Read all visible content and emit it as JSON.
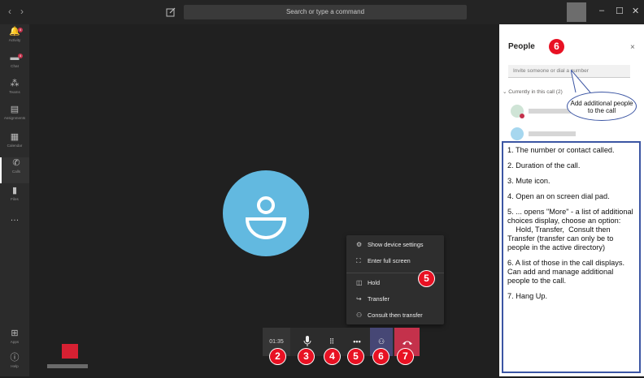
{
  "titlebar": {
    "search_placeholder": "Search or type a command",
    "minimize": "–",
    "maximize": "☐",
    "close": "✕"
  },
  "rail": {
    "items": [
      {
        "label": "Activity",
        "badge": "4"
      },
      {
        "label": "Chat",
        "badge": "4"
      },
      {
        "label": "Teams"
      },
      {
        "label": "Assignments"
      },
      {
        "label": "Calendar"
      },
      {
        "label": "Calls"
      },
      {
        "label": "Files"
      },
      {
        "label": "…"
      }
    ],
    "bottom": [
      {
        "label": "Apps"
      },
      {
        "label": "Help"
      }
    ]
  },
  "call": {
    "duration": "01:35"
  },
  "more_menu": {
    "items": [
      {
        "label": "Show device settings"
      },
      {
        "label": "Enter full screen"
      },
      {
        "label": "Hold"
      },
      {
        "label": "Transfer"
      },
      {
        "label": "Consult then transfer"
      }
    ]
  },
  "markers": {
    "duration": "2",
    "mute": "3",
    "dialpad": "4",
    "more": "5",
    "people": "6",
    "hangup": "7",
    "menu": "5",
    "panel": "6"
  },
  "people_panel": {
    "title": "People",
    "close": "×",
    "invite_placeholder": "Invite someone or dial a number",
    "section_label": "Currently in this call (2)"
  },
  "callout": {
    "text": "Add additional people to the call"
  },
  "legend": [
    "1. The number or contact called.",
    "2. Duration of the call.",
    "3. Mute icon.",
    "4. Open an on screen dial pad.",
    "5. ... opens \"More\" - a list of additional choices display, choose an option:\n    Hold, Transfer,  Consult then Transfer (transfer can only be to people in the active directory)",
    "6. A list of those in the call displays. Can add and manage additional people to the call.",
    "7. Hang Up."
  ],
  "colors": {
    "accent_red": "#e81123",
    "avatar_blue": "#62b9e0",
    "hangup": "#c4314b",
    "callout_border": "#3b55a3"
  }
}
